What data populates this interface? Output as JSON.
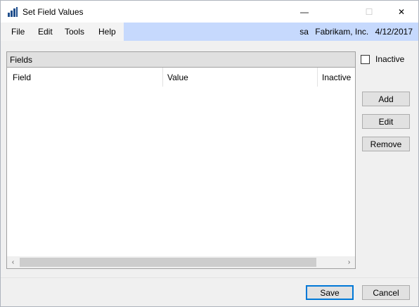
{
  "window": {
    "title": "Set Field Values",
    "icon": "dynamics-gp-app-icon"
  },
  "menu": {
    "items": [
      "File",
      "Edit",
      "Tools",
      "Help"
    ]
  },
  "status": {
    "user": "sa",
    "company": "Fabrikam, Inc.",
    "date": "4/12/2017"
  },
  "fields_panel": {
    "header": "Fields",
    "columns": [
      "Field",
      "Value",
      "Inactive"
    ],
    "rows": []
  },
  "options": {
    "inactive_label": "Inactive",
    "inactive_checked": false
  },
  "buttons": {
    "add": "Add",
    "edit": "Edit",
    "remove": "Remove",
    "save": "Save",
    "cancel": "Cancel"
  },
  "window_controls": {
    "minimize": "—",
    "maximize": "☐",
    "close": "✕"
  },
  "scroll": {
    "left": "‹",
    "right": "›"
  }
}
